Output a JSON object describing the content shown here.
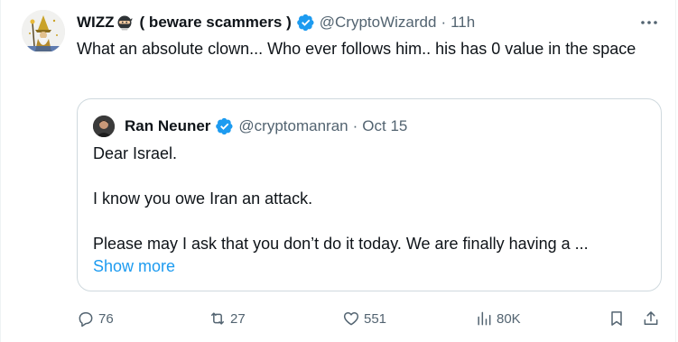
{
  "tweet": {
    "author_name": "WIZZ",
    "author_name_suffix": "( beware scammers )",
    "handle": "@CryptoWizardd",
    "separator": "·",
    "time": "11h",
    "text": "What an absolute clown... Who ever follows him.. his has 0 value in the space"
  },
  "quoted_tweet": {
    "author_name": "Ran Neuner",
    "handle": "@cryptomanran",
    "separator": "·",
    "date": "Oct 15",
    "lines": [
      "Dear Israel.",
      "I know you owe Iran an attack.",
      "Please may I ask that you don’t do it today. We are finally having a ..."
    ],
    "show_more": "Show more"
  },
  "actions": {
    "replies": "76",
    "reposts": "27",
    "likes": "551",
    "views": "80K"
  },
  "colors": {
    "text": "#0f1419",
    "secondary": "#536471",
    "link": "#1d9bf0",
    "verified": "#1d9bf0",
    "border": "#cfd9de"
  },
  "icons": [
    "wizard-avatar",
    "ninja-emoji",
    "verified-badge-icon",
    "more-icon",
    "reply-icon",
    "repost-icon",
    "like-icon",
    "views-icon",
    "bookmark-icon",
    "share-icon"
  ]
}
